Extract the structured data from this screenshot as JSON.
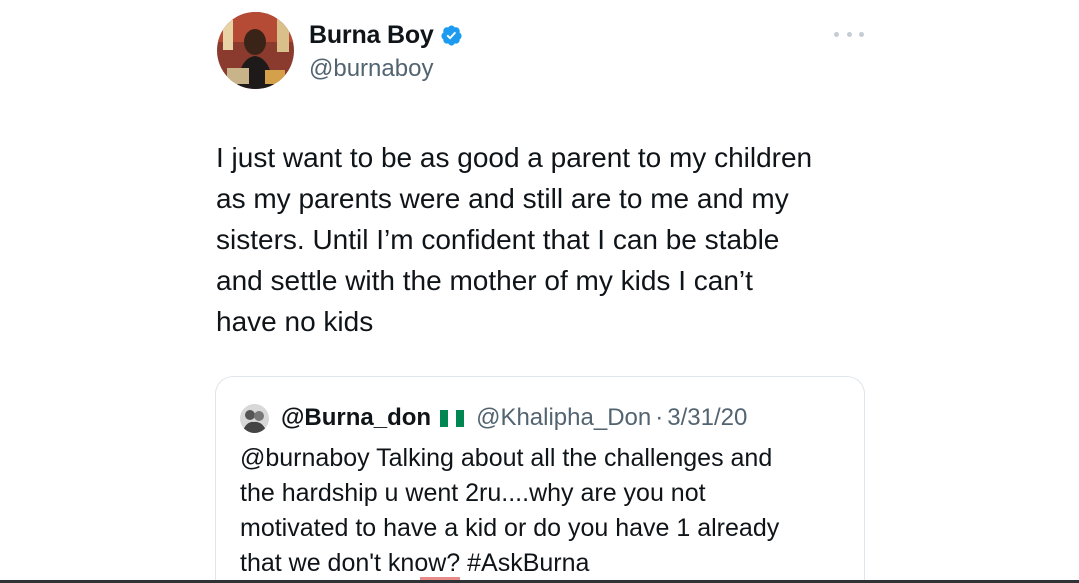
{
  "author": {
    "display_name": "Burna Boy",
    "handle": "@burnaboy",
    "verified": true,
    "avatar_icon": "profile-photo"
  },
  "tweet": {
    "lines": [
      "I just want to be as good a parent to my children",
      "as my parents were and still are to me and my",
      "sisters. Until I’m confident that I can be stable",
      "and settle with the mother of my kids I can’t",
      "have no kids"
    ]
  },
  "quoted_tweet": {
    "display_name": "@Burna_don",
    "flag": "nigeria-flag",
    "handle": "@Khalipha_Don",
    "separator": "·",
    "date": "3/31/20",
    "lines": [
      "@burnaboy Talking about all the challenges and",
      "the hardship u went 2ru....why are you not",
      "motivated to have a kid or do you have 1 already",
      "that we don't know? #AskBurna"
    ]
  },
  "colors": {
    "text_primary": "#0f1419",
    "text_secondary": "#536471",
    "verified_blue": "#1d9bf0",
    "border": "#dfe5ea",
    "flag_green": "#008751"
  }
}
